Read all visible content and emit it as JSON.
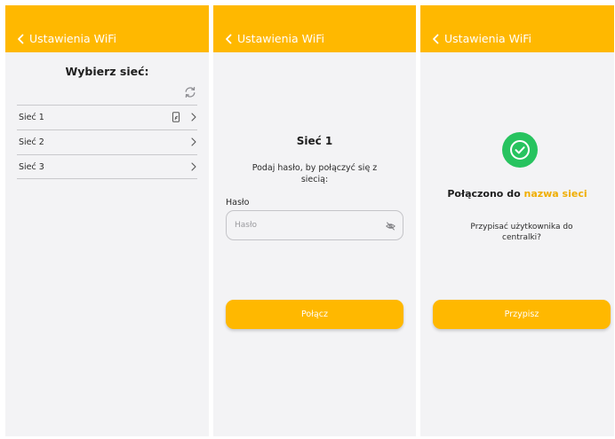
{
  "colors": {
    "accent": "#ffb800",
    "success": "#27c35f",
    "background": "#f3f3f5"
  },
  "screen1": {
    "header": {
      "back_icon": "chevron-left-icon",
      "title": "Ustawienia WiFi"
    },
    "title": "Wybierz sieć:",
    "refresh_icon": "refresh-icon",
    "networks": [
      {
        "label": "Sieć 1",
        "icon": "wifi-device-icon"
      },
      {
        "label": "Sieć 2"
      },
      {
        "label": "Sieć 3"
      }
    ]
  },
  "screen2": {
    "header": {
      "back_icon": "chevron-left-icon",
      "title": "Ustawienia WiFi"
    },
    "title": "Sieć 1",
    "instruction": "Podaj hasło, by połączyć się z siecią:",
    "password": {
      "label": "Hasło",
      "placeholder": "Hasło",
      "value": "",
      "toggle_icon": "eye-off-icon"
    },
    "connect_label": "Połącz"
  },
  "screen3": {
    "header": {
      "back_icon": "chevron-left-icon",
      "title": "Ustawienia WiFi"
    },
    "success_icon": "check-circle-icon",
    "status_prefix": "Połączono do",
    "status_network": "nazwa sieci",
    "question": "Przypisać użytkownika do centralki?",
    "assign_label": "Przypisz"
  }
}
